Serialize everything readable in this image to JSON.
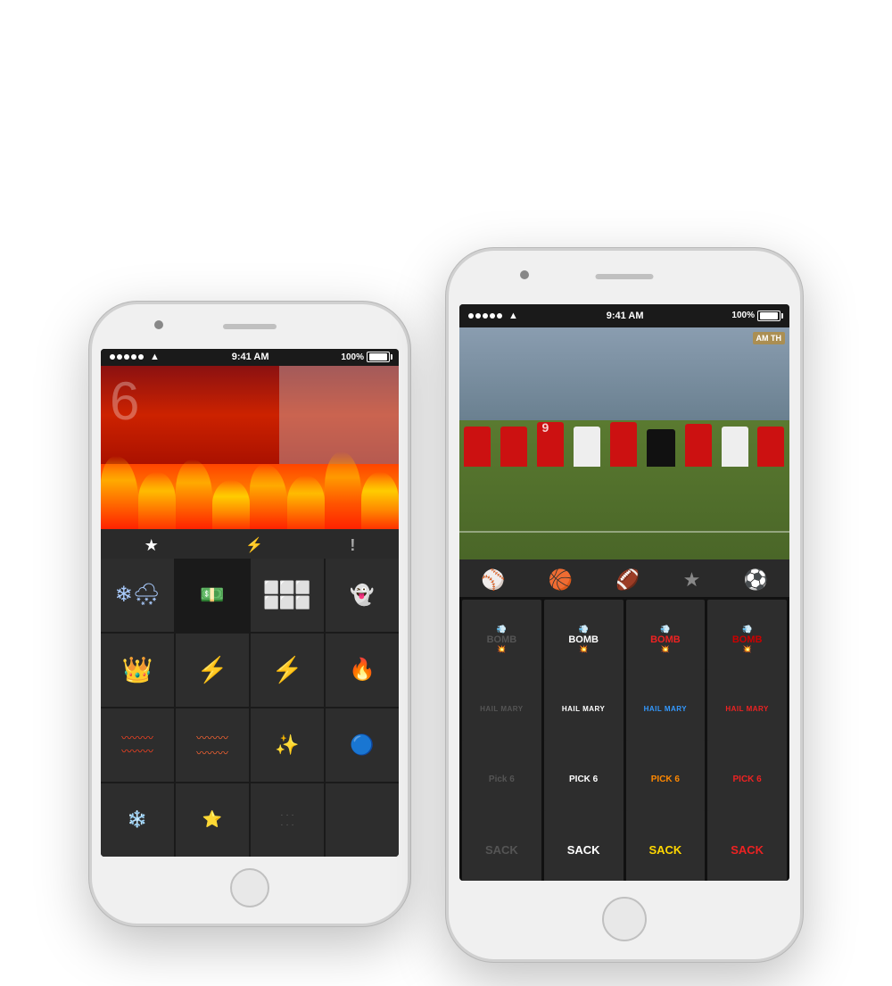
{
  "phones": {
    "phone1": {
      "status": {
        "dots": 5,
        "wifi": "wifi",
        "time": "9:41 AM",
        "battery": "100%"
      },
      "tabs": [
        {
          "icon": "★",
          "active": true
        },
        {
          "icon": "⚡",
          "active": false
        },
        {
          "icon": "!",
          "active": false
        }
      ],
      "stickers": [
        {
          "type": "snow",
          "label": ""
        },
        {
          "type": "money",
          "label": ""
        },
        {
          "type": "popcorn",
          "label": ""
        },
        {
          "type": "ghost",
          "label": ""
        },
        {
          "type": "crown",
          "label": ""
        },
        {
          "type": "lightning",
          "label": ""
        },
        {
          "type": "bolt",
          "label": ""
        },
        {
          "type": "fireball",
          "label": ""
        },
        {
          "type": "wave",
          "label": ""
        },
        {
          "type": "wave2",
          "label": ""
        },
        {
          "type": "sparkle",
          "label": ""
        },
        {
          "type": "orb",
          "label": ""
        },
        {
          "type": "snowflake",
          "label": ""
        },
        {
          "type": "star2",
          "label": ""
        },
        {
          "type": "dots",
          "label": ""
        },
        {
          "type": "blank",
          "label": ""
        }
      ]
    },
    "phone2": {
      "status": {
        "dots": 5,
        "wifi": "wifi",
        "time": "9:41 AM",
        "battery": "100%"
      },
      "sport_tabs": [
        {
          "icon": "⚾",
          "label": "baseball",
          "active": false
        },
        {
          "icon": "🏀",
          "label": "basketball",
          "active": false
        },
        {
          "icon": "🏈",
          "label": "football",
          "active": true
        },
        {
          "icon": "★",
          "label": "star",
          "active": false
        },
        {
          "icon": "⚽",
          "label": "soccer",
          "active": false
        }
      ],
      "stadium_label": "AM TH",
      "sticker_rows": [
        {
          "label": "BOMB",
          "items": [
            {
              "text": "BOMB",
              "sub": "💥",
              "color": "dark",
              "bg": "#2d2d2d"
            },
            {
              "text": "BOMB",
              "sub": "💥",
              "color": "white",
              "bg": "#2d2d2d"
            },
            {
              "text": "BOMB",
              "sub": "💥",
              "color": "red",
              "bg": "#2d2d2d"
            },
            {
              "text": "BOMB",
              "sub": "💥",
              "color": "dark-red",
              "bg": "#2d2d2d"
            }
          ]
        },
        {
          "label": "HAIL MARY",
          "items": [
            {
              "text": "HAIL MARY",
              "color": "dark",
              "bg": "#2d2d2d"
            },
            {
              "text": "HAIL MARY",
              "color": "white",
              "bg": "#2d2d2d"
            },
            {
              "text": "HAIL MARY",
              "color": "blue",
              "bg": "#2d2d2d"
            },
            {
              "text": "HAIL MARY",
              "color": "red",
              "bg": "#2d2d2d"
            }
          ]
        },
        {
          "label": "PICK 6",
          "items": [
            {
              "text": "PICK 6",
              "color": "dark",
              "bg": "#2d2d2d"
            },
            {
              "text": "PICK 6",
              "color": "white",
              "bg": "#2d2d2d"
            },
            {
              "text": "PICK 6",
              "color": "orange",
              "bg": "#2d2d2d"
            },
            {
              "text": "PICK 6",
              "color": "red",
              "bg": "#2d2d2d"
            }
          ]
        },
        {
          "label": "SACK",
          "items": [
            {
              "text": "SACK",
              "color": "dark",
              "bg": "#2d2d2d"
            },
            {
              "text": "SACK",
              "color": "white",
              "bg": "#2d2d2d"
            },
            {
              "text": "SACK",
              "color": "yellow",
              "bg": "#2d2d2d"
            },
            {
              "text": "SACK",
              "color": "red",
              "bg": "#2d2d2d"
            }
          ]
        }
      ]
    }
  }
}
